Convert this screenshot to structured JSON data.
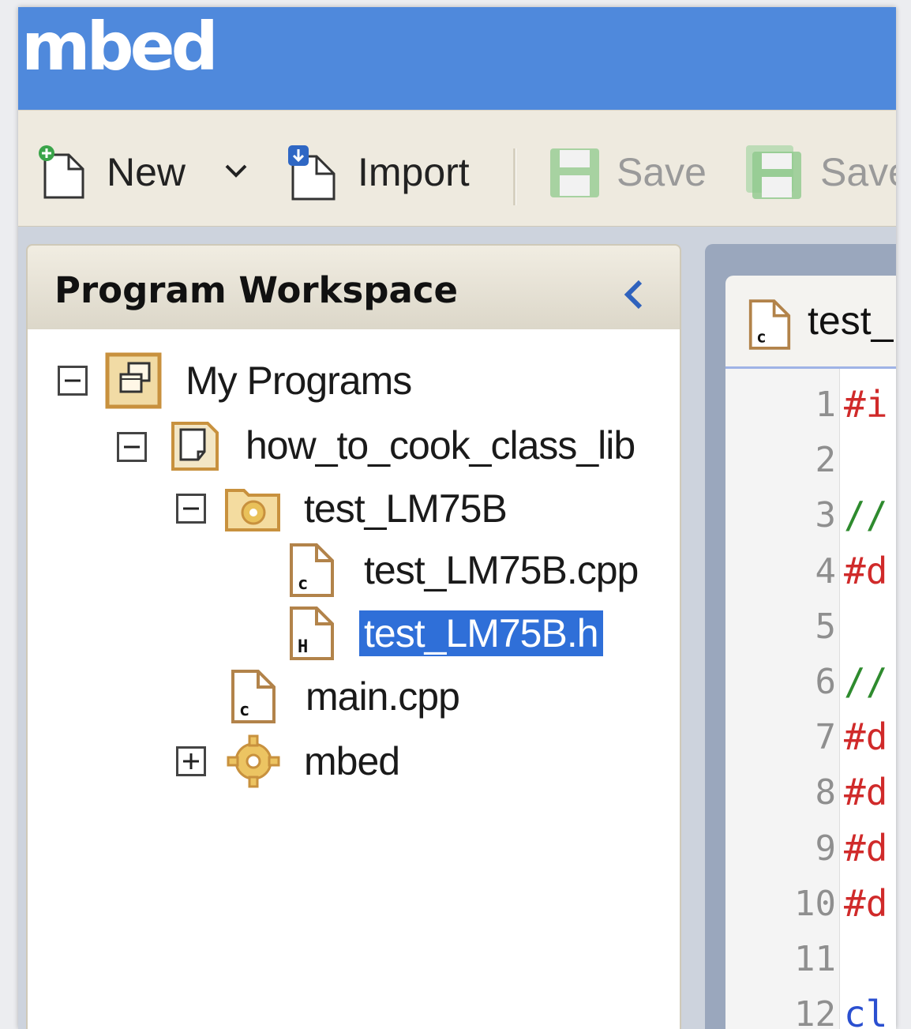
{
  "app": {
    "brand": "mbed"
  },
  "toolbar": {
    "new_label": "New",
    "import_label": "Import",
    "save_label": "Save",
    "save_all_label": "Save"
  },
  "workspace": {
    "title": "Program Workspace",
    "tree": {
      "my_programs": "My Programs",
      "program": "how_to_cook_class_lib",
      "folder": "test_LM75B",
      "file_cpp": "test_LM75B.cpp",
      "file_h": "test_LM75B.h",
      "main": "main.cpp",
      "lib": "mbed"
    }
  },
  "editor": {
    "tab_label": "test_",
    "lines": [
      {
        "num": "1",
        "text": "#i",
        "color": "#d02a2a"
      },
      {
        "num": "2",
        "text": "",
        "color": "#222222"
      },
      {
        "num": "3",
        "text": "//",
        "color": "#2e8b2e"
      },
      {
        "num": "4",
        "text": "#d",
        "color": "#d02a2a"
      },
      {
        "num": "5",
        "text": "",
        "color": "#222222"
      },
      {
        "num": "6",
        "text": "//",
        "color": "#2e8b2e"
      },
      {
        "num": "7",
        "text": "#d",
        "color": "#d02a2a"
      },
      {
        "num": "8",
        "text": "#d",
        "color": "#d02a2a"
      },
      {
        "num": "9",
        "text": "#d",
        "color": "#d02a2a"
      },
      {
        "num": "10",
        "text": "#d",
        "color": "#d02a2a"
      },
      {
        "num": "11",
        "text": "",
        "color": "#222222"
      },
      {
        "num": "12",
        "text": "cl",
        "color": "#2a4fd0"
      }
    ]
  },
  "colors": {
    "accent": "#4f89dc",
    "selection": "#2f6fd8",
    "icon_tan": "#c8913e"
  }
}
